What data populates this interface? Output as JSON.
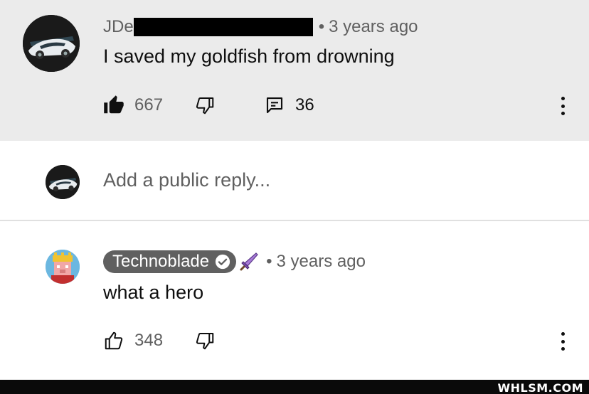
{
  "comment": {
    "author_visible": "JDe",
    "separator": "•",
    "timestamp": "3 years ago",
    "text": "I saved my goldfish from drowning",
    "likes": "667",
    "replies": "36"
  },
  "reply_box": {
    "placeholder": "Add a public reply..."
  },
  "reply": {
    "author": "Technoblade",
    "separator": "•",
    "timestamp": "3 years ago",
    "text": "what a hero",
    "likes": "348"
  },
  "watermark": "WHLSM.COM",
  "colors": {
    "top_comment_bg": "#ebebeb",
    "secondary_text": "#606060",
    "name_pill": "#606060"
  }
}
